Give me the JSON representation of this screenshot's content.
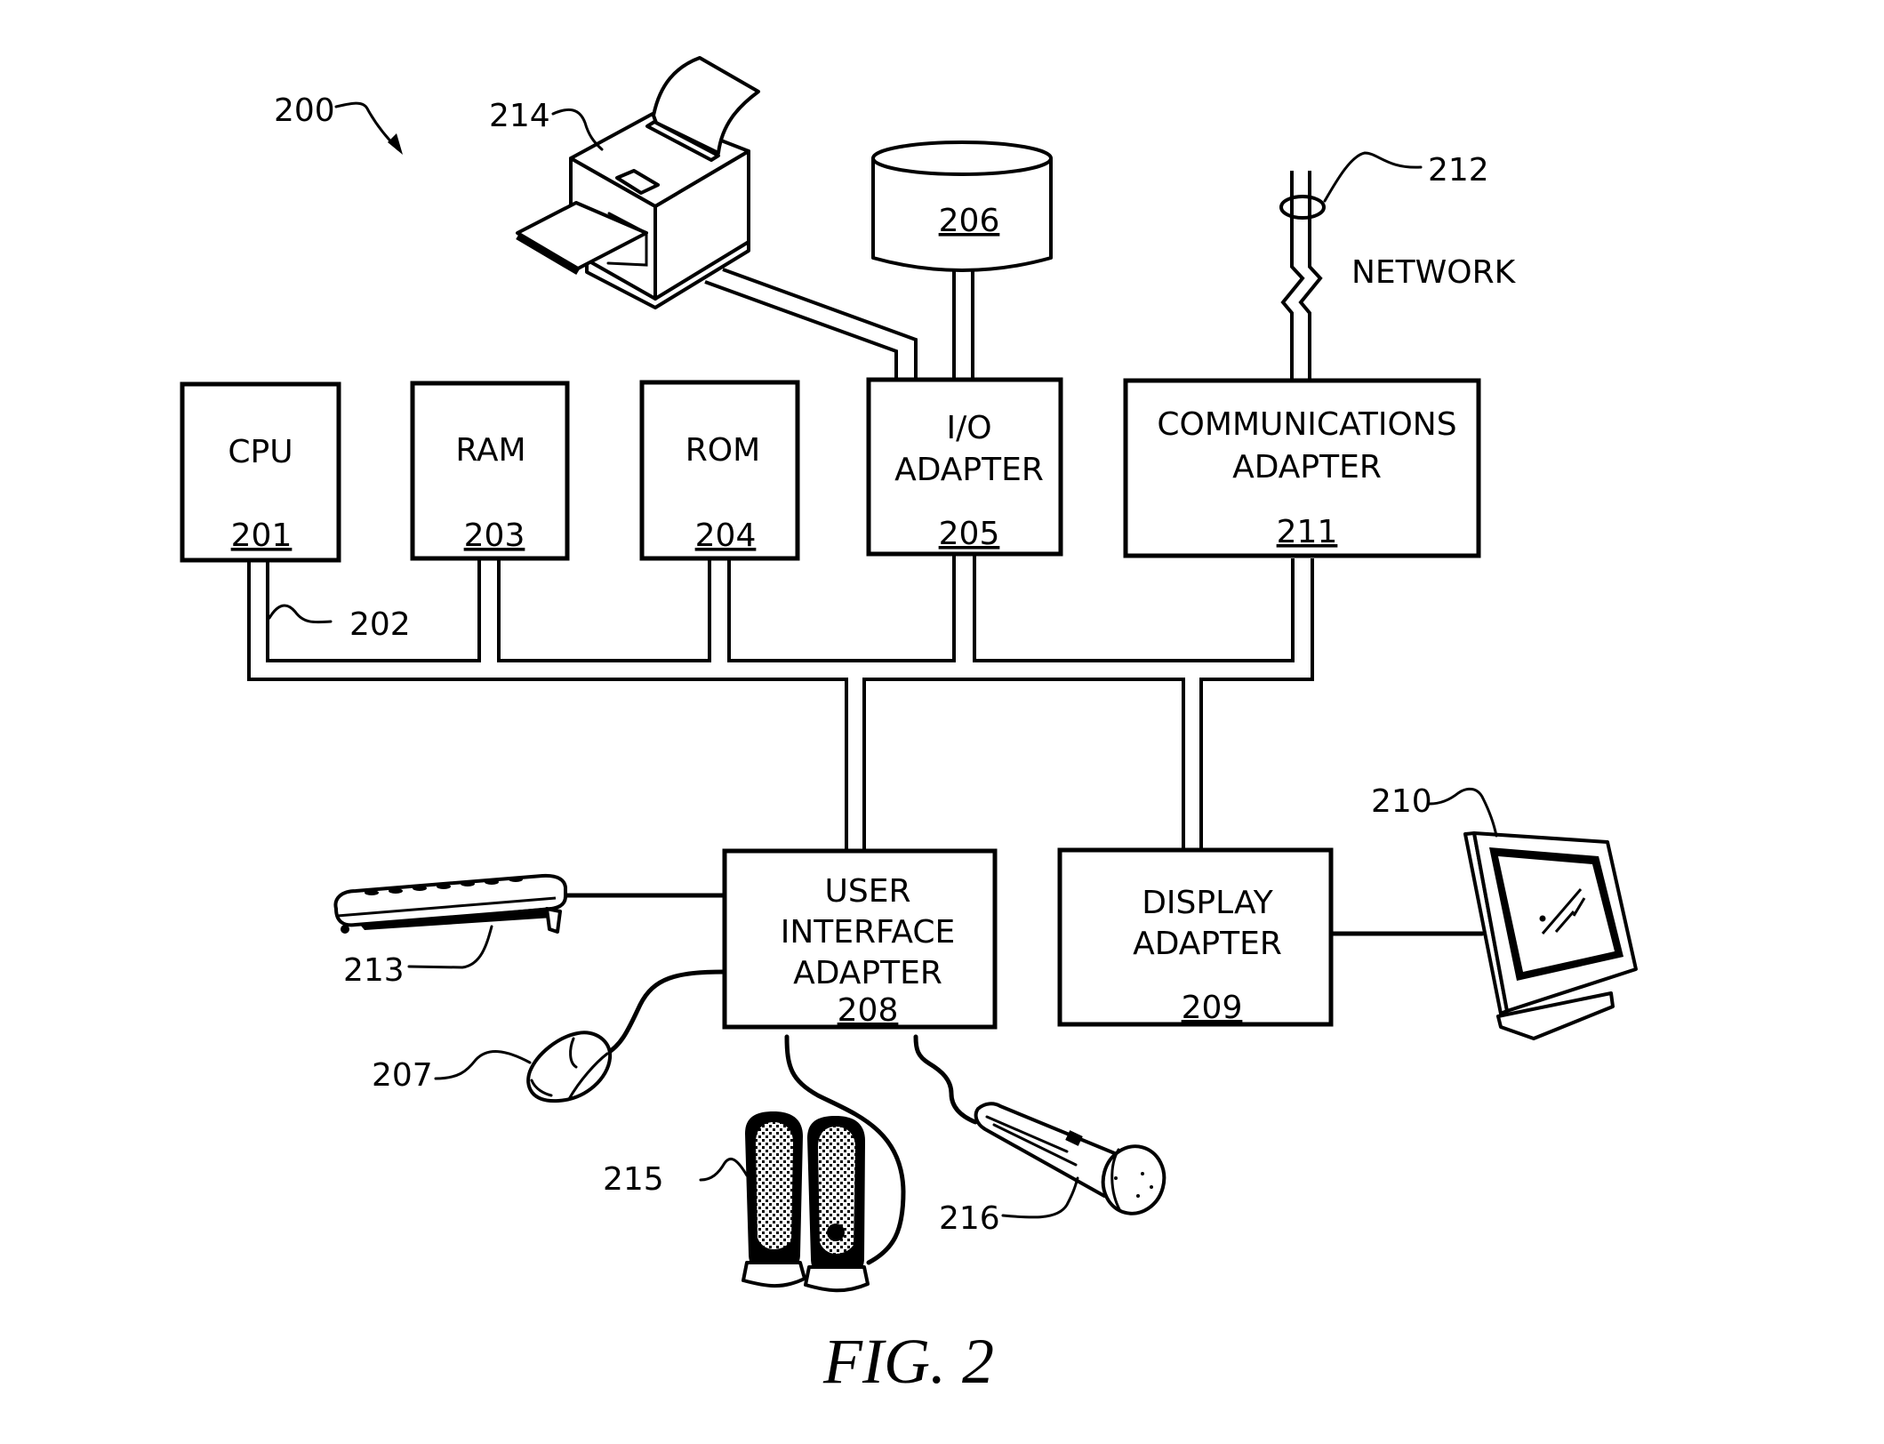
{
  "figure": {
    "caption": "FIG. 2",
    "system_ref": "200"
  },
  "components": {
    "cpu": {
      "label": "CPU",
      "ref": "201"
    },
    "ram": {
      "label": "RAM",
      "ref": "203"
    },
    "rom": {
      "label": "ROM",
      "ref": "204"
    },
    "io_adapter": {
      "line1": "I/O",
      "line2": "ADAPTER",
      "ref": "205"
    },
    "storage": {
      "ref": "206"
    },
    "comm_adapter": {
      "line1": "COMMUNICATIONS",
      "line2": "ADAPTER",
      "ref": "211"
    },
    "ui_adapter": {
      "line1": "USER",
      "line2": "INTERFACE",
      "line3": "ADAPTER",
      "ref": "208"
    },
    "display_adapter": {
      "line1": "DISPLAY",
      "line2": "ADAPTER",
      "ref": "209"
    }
  },
  "callouts": {
    "bus": "202",
    "mouse": "207",
    "display": "210",
    "network_link": "212",
    "keyboard": "213",
    "printer": "214",
    "speakers": "215",
    "microphone": "216"
  },
  "network_label": "NETWORK"
}
